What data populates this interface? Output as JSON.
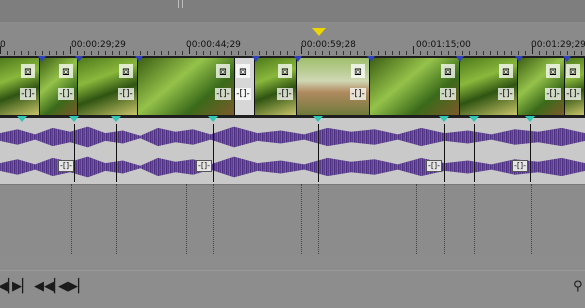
{
  "timeline": {
    "timecodes": [
      "0",
      "00:00:29;29",
      "00:00:44;29",
      "00:00:59;28",
      "00:01:15;00",
      "00:01:29;29"
    ]
  },
  "video_clips": [
    {
      "style": "normal",
      "fx": "⧈",
      "cut": "-[]-"
    },
    {
      "style": "alt",
      "fx": "⧈",
      "cut": "-[]-"
    },
    {
      "style": "normal",
      "fx": "⧈",
      "cut": "-[]-"
    },
    {
      "style": "alt",
      "fx": "⧈",
      "cut": "-[]-"
    },
    {
      "style": "sel",
      "fx": "⧈",
      "cut": "-[]-"
    },
    {
      "style": "normal",
      "fx": "⧈",
      "cut": "-[]-"
    },
    {
      "style": "fish",
      "fx": "⧈",
      "cut": "-[]-"
    },
    {
      "style": "alt",
      "fx": "⧈",
      "cut": "-[]-"
    },
    {
      "style": "normal",
      "fx": "⧈",
      "cut": "-[]-"
    },
    {
      "style": "alt",
      "fx": "⧈",
      "cut": "-[]-"
    },
    {
      "style": "normal",
      "fx": "⧈",
      "cut": "-[]-"
    }
  ],
  "audio": {
    "fx_label": "-[]-"
  },
  "transport": {
    "buttons": [
      "◀▏",
      "▶▏",
      "◀◀▏",
      "◀▶▏"
    ],
    "right_icon": "⚲"
  },
  "colors": {
    "playhead": "#ecd500",
    "waveform": "#5a3c8e",
    "marker": "#3344bb",
    "audio_key": "#30c7b4"
  }
}
